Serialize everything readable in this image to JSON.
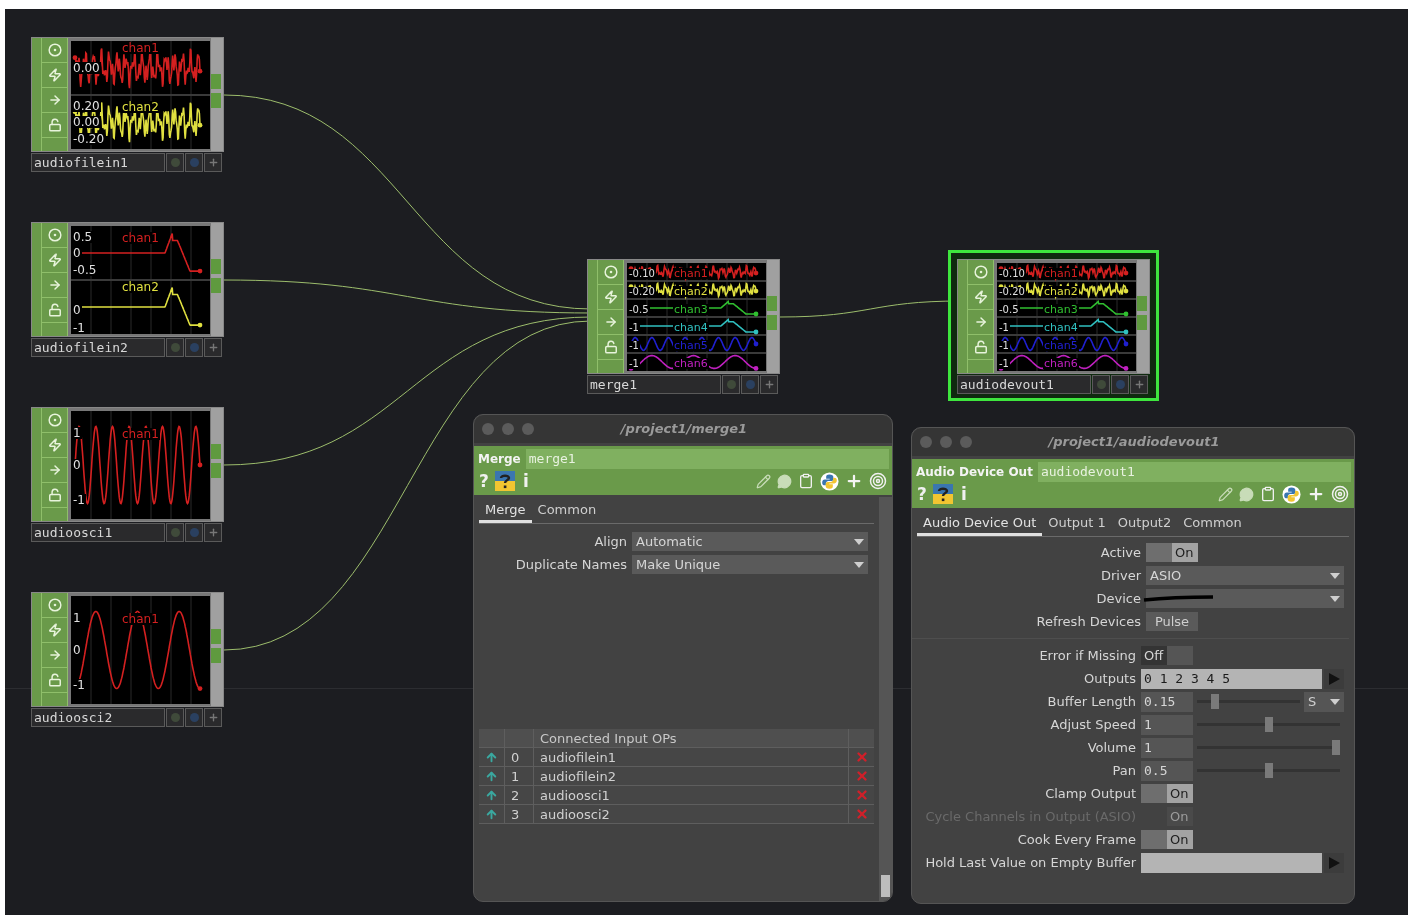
{
  "nodes": [
    {
      "name": "audiofilein1",
      "selected": false,
      "traces": [
        {
          "label": "chan1",
          "color": "#d42020",
          "kind": "noise",
          "ticks": [
            "0.00"
          ]
        },
        {
          "label": "chan2",
          "color": "#e0e040",
          "kind": "noise",
          "ticks": [
            "0.20",
            "0.00",
            "-0.20"
          ]
        }
      ]
    },
    {
      "name": "audiofilein2",
      "selected": false,
      "traces": [
        {
          "label": "chan1",
          "color": "#d42020",
          "kind": "envelope",
          "ticks": [
            "0.5",
            "0",
            "-0.5"
          ]
        },
        {
          "label": "chan2",
          "color": "#e0e040",
          "kind": "envelope",
          "ticks": [
            "0",
            "-1"
          ]
        }
      ]
    },
    {
      "name": "audioosci1",
      "selected": false,
      "traces": [
        {
          "label": "chan1",
          "color": "#d42020",
          "kind": "sine",
          "ticks": [
            "1",
            "0",
            "-1"
          ]
        }
      ]
    },
    {
      "name": "audioosci2",
      "selected": false,
      "traces": [
        {
          "label": "chan1",
          "color": "#d42020",
          "kind": "slowsine",
          "ticks": [
            "1",
            "0",
            "-1"
          ]
        }
      ]
    },
    {
      "name": "merge1",
      "selected": false,
      "traces": [
        {
          "label": "chan1",
          "color": "#d42020",
          "kind": "noise",
          "ticks": [
            "-0.10"
          ]
        },
        {
          "label": "chan2",
          "color": "#e0e040",
          "kind": "noise",
          "ticks": [
            "-0.20"
          ]
        },
        {
          "label": "chan3",
          "color": "#30c030",
          "kind": "envelope",
          "ticks": [
            "-0.5"
          ]
        },
        {
          "label": "chan4",
          "color": "#30c0c0",
          "kind": "envelope",
          "ticks": [
            "-1"
          ]
        },
        {
          "label": "chan5",
          "color": "#2020d0",
          "kind": "sine",
          "ticks": [
            "-1"
          ]
        },
        {
          "label": "chan6",
          "color": "#c020c0",
          "kind": "slowsine",
          "ticks": [
            "-1"
          ]
        }
      ]
    },
    {
      "name": "audiodevout1",
      "selected": true,
      "traces": [
        {
          "label": "chan1",
          "color": "#d42020",
          "kind": "noise",
          "ticks": [
            "-0.10"
          ]
        },
        {
          "label": "chan2",
          "color": "#e0e040",
          "kind": "noise",
          "ticks": [
            "-0.20"
          ]
        },
        {
          "label": "chan3",
          "color": "#30c030",
          "kind": "envelope",
          "ticks": [
            "-0.5"
          ]
        },
        {
          "label": "chan4",
          "color": "#30c0c0",
          "kind": "envelope",
          "ticks": [
            "-1"
          ]
        },
        {
          "label": "chan5",
          "color": "#2020d0",
          "kind": "sine",
          "ticks": [
            "-1"
          ]
        },
        {
          "label": "chan6",
          "color": "#c020c0",
          "kind": "slowsine",
          "ticks": [
            "-1"
          ]
        }
      ]
    }
  ],
  "merge_panel": {
    "title": "/project1/merge1",
    "op_type": "Merge",
    "op_name": "merge1",
    "toolbar_glyphs": [
      "?",
      "i"
    ],
    "tabs": [
      {
        "label": "Merge",
        "selected": true
      },
      {
        "label": "Common",
        "selected": false
      }
    ],
    "params": [
      {
        "label": "Align",
        "value": "Automatic"
      },
      {
        "label": "Duplicate Names",
        "value": "Make Unique"
      }
    ],
    "table": {
      "header": "Connected Input OPs",
      "rows": [
        {
          "index": "0",
          "name": "audiofilein1"
        },
        {
          "index": "1",
          "name": "audiofilein2"
        },
        {
          "index": "2",
          "name": "audioosci1"
        },
        {
          "index": "3",
          "name": "audioosci2"
        }
      ]
    }
  },
  "devout_panel": {
    "title": "/project1/audiodevout1",
    "op_type": "Audio Device Out",
    "op_name": "audiodevout1",
    "toolbar_glyphs": [
      "?",
      "i"
    ],
    "tabs": [
      {
        "label": "Audio Device Out",
        "selected": true
      },
      {
        "label": "Output 1",
        "selected": false
      },
      {
        "label": "Output2",
        "selected": false
      },
      {
        "label": "Common",
        "selected": false
      }
    ],
    "param_groups": [
      [
        {
          "kind": "toggle",
          "label": "Active",
          "value": "On",
          "on": true,
          "disabled": false
        },
        {
          "kind": "menu",
          "label": "Driver",
          "value": "ASIO",
          "disabled": false
        },
        {
          "kind": "menu",
          "label": "Device",
          "redacted": true,
          "disabled": false
        },
        {
          "kind": "pulse",
          "label": "Refresh Devices",
          "value": "Pulse",
          "disabled": false
        }
      ],
      [
        {
          "kind": "toggle",
          "label": "Error if Missing",
          "value": "Off",
          "on": false,
          "disabled": false
        },
        {
          "kind": "string",
          "label": "Outputs",
          "value": "0 1 2 3 4 5",
          "disabled": false
        },
        {
          "kind": "slider",
          "label": "Buffer Length",
          "value": "0.15",
          "level": 0.15,
          "unit": "S",
          "disabled": false
        },
        {
          "kind": "slider",
          "label": "Adjust Speed",
          "value": "1",
          "level": 0.5,
          "disabled": false
        },
        {
          "kind": "slider",
          "label": "Volume",
          "value": "1",
          "level": 1,
          "disabled": false
        },
        {
          "kind": "slider",
          "label": "Pan",
          "value": "0.5",
          "level": 0.5,
          "disabled": false
        },
        {
          "kind": "toggle",
          "label": "Clamp Output",
          "value": "On",
          "on": true,
          "disabled": false
        },
        {
          "kind": "toggle",
          "label": "Cycle Channels in Output (ASIO)",
          "value": "On",
          "on": true,
          "disabled": true
        },
        {
          "kind": "toggle",
          "label": "Cook Every Frame",
          "value": "On",
          "on": true,
          "disabled": false
        },
        {
          "kind": "string",
          "label": "Hold Last Value on Empty Buffer",
          "disabled": false
        }
      ]
    ]
  }
}
